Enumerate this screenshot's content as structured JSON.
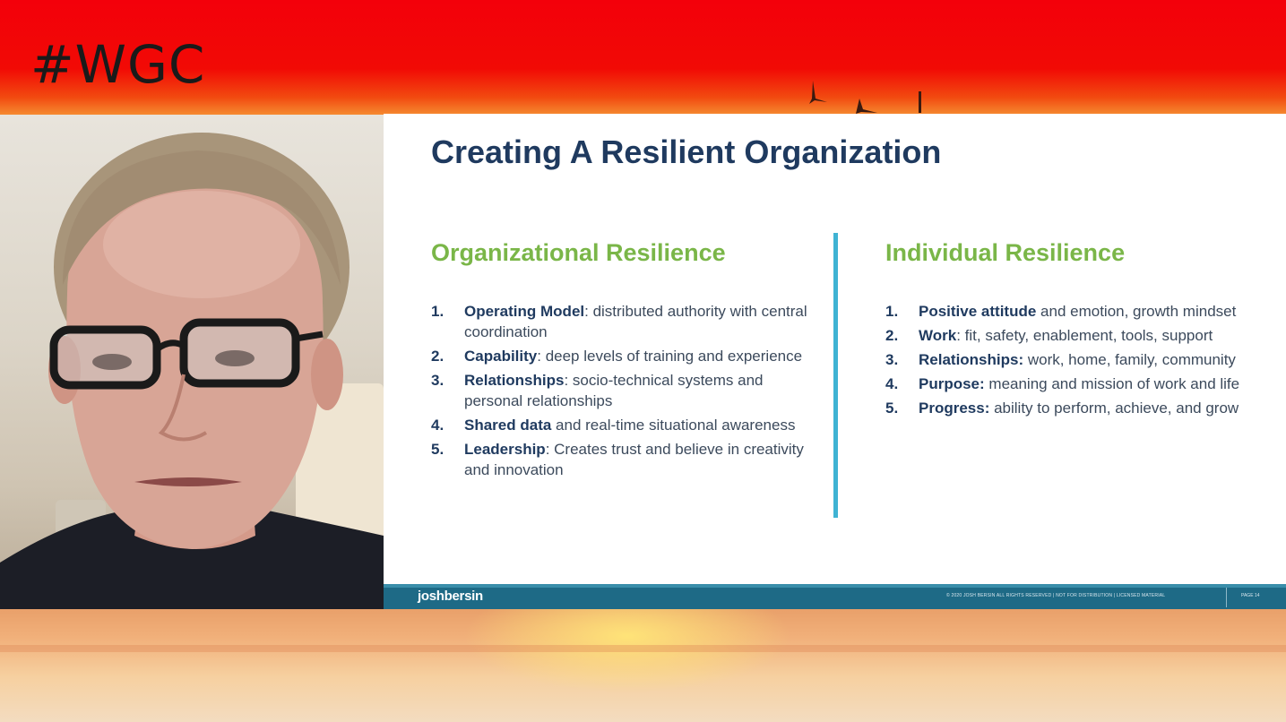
{
  "banner": {
    "hashtag": "#WGC",
    "background_color": "#f3000a"
  },
  "webcam": {
    "description_icon": "video-feed"
  },
  "slide": {
    "title": "Creating A Resilient Organization",
    "left_column": {
      "heading": "Organizational Resilience",
      "items": [
        {
          "num": "1.",
          "bold": "Operating Model",
          "rest": ": distributed authority with central coordination"
        },
        {
          "num": "2.",
          "bold": "Capability",
          "rest": ": deep levels of training and experience"
        },
        {
          "num": "3.",
          "bold": "Relationships",
          "rest": ": socio-technical systems and personal relationships"
        },
        {
          "num": "4.",
          "bold": "Shared data",
          "rest": " and real-time situational awareness"
        },
        {
          "num": "5.",
          "bold": "Leadership",
          "rest": ": Creates trust and believe in creativity and innovation"
        }
      ]
    },
    "right_column": {
      "heading": "Individual Resilience",
      "items": [
        {
          "num": "1.",
          "bold": "Positive attitude",
          "rest": " and emotion, growth mindset"
        },
        {
          "num": "2.",
          "bold": "Work",
          "rest": ": fit, safety, enablement, tools, support"
        },
        {
          "num": "3.",
          "bold": "Relationships:",
          "rest": " work, home, family, community"
        },
        {
          "num": "4.",
          "bold": "Purpose:",
          "rest": " meaning and mission of work and life"
        },
        {
          "num": "5.",
          "bold": "Progress:",
          "rest": " ability to perform, achieve, and grow"
        }
      ]
    },
    "footer": {
      "brand": "joshbersin",
      "copyright": "© 2020 JOSH BERSIN ALL RIGHTS RESERVED | NOT FOR DISTRIBUTION | LICENSED MATERIAL",
      "page": "PAGE 14"
    },
    "colors": {
      "title": "#1f3a5f",
      "heading": "#7ab648",
      "divider": "#3fb3d3",
      "footer": "#1e6a86"
    }
  }
}
